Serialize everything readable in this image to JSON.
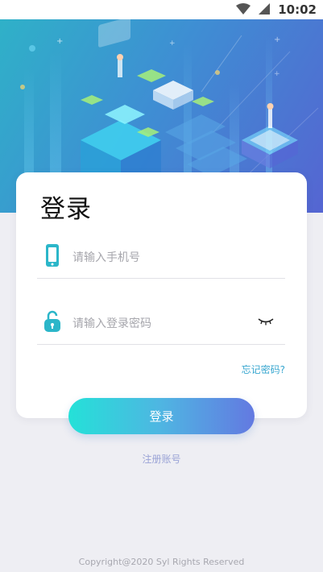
{
  "status_bar": {
    "time": "10:02",
    "icons": [
      "wifi-icon",
      "signal-icon"
    ]
  },
  "hero": {
    "illustration": "isometric-data-center-illustration"
  },
  "login_card": {
    "title": "登录",
    "phone_field": {
      "placeholder": "请输入手机号",
      "value": "",
      "icon": "phone-icon"
    },
    "password_field": {
      "placeholder": "请输入登录密码",
      "value": "",
      "icon": "lock-icon",
      "toggle_icon": "eye-closed-icon"
    },
    "forgot_password": "忘记密码?"
  },
  "login_button": {
    "label": "登录"
  },
  "register_link": "注册账号",
  "footer": {
    "copyright": "Copyright@2020 Syl Rights Reserved"
  },
  "colors": {
    "accent": "#2bb6c9",
    "button_gradient_start": "#24e1d8",
    "button_gradient_end": "#6379e1",
    "link": "#39a7d0",
    "background": "#eeeef3"
  }
}
